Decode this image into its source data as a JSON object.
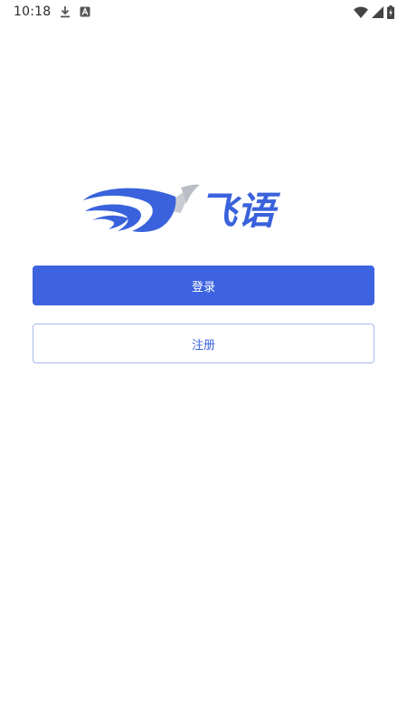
{
  "status_bar": {
    "time": "10:18",
    "icons": [
      "download-icon",
      "text-notification-icon",
      "wifi-icon",
      "signal-icon",
      "battery-charging-icon"
    ]
  },
  "logo": {
    "text": "飞语",
    "brand_blue": "#3a62dc",
    "accent_gray": "#c9cdd3"
  },
  "actions": {
    "login_label": "登录",
    "register_label": "注册"
  },
  "colors": {
    "primary": "#3d63e0",
    "primary_border": "#a8b9ee",
    "background": "#ffffff"
  }
}
